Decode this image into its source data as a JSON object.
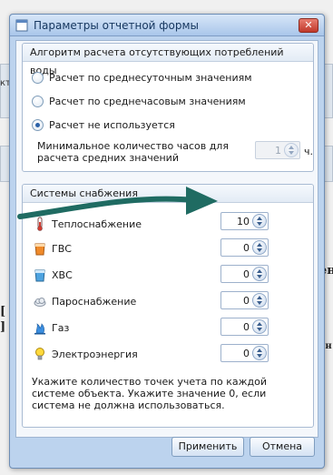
{
  "background": {
    "left_fragments": [
      "кт",
      "[",
      "]"
    ],
    "right_fragments": [
      "ен",
      "ен"
    ]
  },
  "dialog": {
    "title": "Параметры отчетной формы",
    "close_label": "✕",
    "algorithm": {
      "header": "Алгоритм расчета отсутствующих потреблений воды",
      "options": [
        {
          "label": "Расчет по среднесуточным значениям",
          "checked": false
        },
        {
          "label": "Расчет по среднечасовым значениям",
          "checked": false
        },
        {
          "label": "Расчет не используется",
          "checked": true
        }
      ],
      "min_hours_label": "Минимальное количество часов для расчета средних значений",
      "min_hours_value": "1",
      "min_hours_unit": "ч."
    },
    "systems": {
      "header": "Системы снабжения",
      "items": [
        {
          "label": "Теплоснабжение",
          "value": "10",
          "icon": "thermometer-icon"
        },
        {
          "label": "ГВС",
          "value": "0",
          "icon": "hot-water-icon"
        },
        {
          "label": "ХВС",
          "value": "0",
          "icon": "cold-water-icon"
        },
        {
          "label": "Пароснабжение",
          "value": "0",
          "icon": "steam-cloud-icon"
        },
        {
          "label": "Газ",
          "value": "0",
          "icon": "gas-flame-icon"
        },
        {
          "label": "Электроэнергия",
          "value": "0",
          "icon": "lightbulb-icon"
        }
      ],
      "hint": "Укажите количество точек учета по каждой системе объекта. Укажите значение 0, если система не должна использоваться."
    },
    "buttons": {
      "apply": "Применить",
      "cancel": "Отмена"
    }
  }
}
